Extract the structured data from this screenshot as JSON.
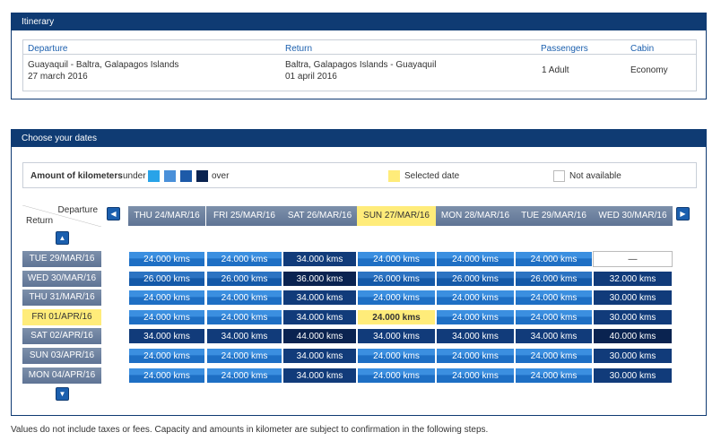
{
  "itinerary": {
    "title": "Itinerary",
    "headers": {
      "departure": "Departure",
      "return": "Return",
      "passengers": "Passengers",
      "cabin": "Cabin"
    },
    "departure_route": "Guayaquil - Baltra, Galapagos Islands",
    "departure_date": "27 march 2016",
    "return_route": "Baltra, Galapagos Islands - Guayaquil",
    "return_date": "01 april 2016",
    "passengers": "1 Adult",
    "cabin": "Economy"
  },
  "dates": {
    "title": "Choose your dates",
    "legend": {
      "amount_label": "Amount of kilometers",
      "under": "under",
      "over": "over",
      "selected": "Selected date",
      "not_available": "Not available",
      "colors": [
        "#29a3e8",
        "#4a90d9",
        "#1d5aa8",
        "#0a2350"
      ]
    },
    "corner": {
      "departure": "Departure",
      "return": "Return"
    },
    "nav": {
      "prev": "◀",
      "next": "▶",
      "up": "▲",
      "down": "▼"
    },
    "columns": [
      "THU 24/MAR/16",
      "FRI 25/MAR/16",
      "SAT 26/MAR/16",
      "SUN 27/MAR/16",
      "MON 28/MAR/16",
      "TUE 29/MAR/16",
      "WED 30/MAR/16"
    ],
    "rows": [
      {
        "label": "TUE 29/MAR/16",
        "cells": [
          "24.000 kms",
          "24.000 kms",
          "34.000 kms",
          "24.000 kms",
          "24.000 kms",
          "24.000 kms",
          "—"
        ]
      },
      {
        "label": "WED 30/MAR/16",
        "cells": [
          "26.000 kms",
          "26.000 kms",
          "36.000 kms",
          "26.000 kms",
          "26.000 kms",
          "26.000 kms",
          "32.000 kms"
        ]
      },
      {
        "label": "THU 31/MAR/16",
        "cells": [
          "24.000 kms",
          "24.000 kms",
          "34.000 kms",
          "24.000 kms",
          "24.000 kms",
          "24.000 kms",
          "30.000 kms"
        ]
      },
      {
        "label": "FRI 01/APR/16",
        "cells": [
          "24.000 kms",
          "24.000 kms",
          "34.000 kms",
          "24.000 kms",
          "24.000 kms",
          "24.000 kms",
          "30.000 kms"
        ]
      },
      {
        "label": "SAT 02/APR/16",
        "cells": [
          "34.000 kms",
          "34.000 kms",
          "44.000 kms",
          "34.000 kms",
          "34.000 kms",
          "34.000 kms",
          "40.000 kms"
        ]
      },
      {
        "label": "SUN 03/APR/16",
        "cells": [
          "24.000 kms",
          "24.000 kms",
          "34.000 kms",
          "24.000 kms",
          "24.000 kms",
          "24.000 kms",
          "30.000 kms"
        ]
      },
      {
        "label": "MON 04/APR/16",
        "cells": [
          "24.000 kms",
          "24.000 kms",
          "34.000 kms",
          "24.000 kms",
          "24.000 kms",
          "24.000 kms",
          "30.000 kms"
        ]
      }
    ],
    "selected_column": 3,
    "selected_row": 3
  },
  "footer": "Values do not include taxes or fees. Capacity and amounts in kilometer are subject to confirmation in the following steps."
}
